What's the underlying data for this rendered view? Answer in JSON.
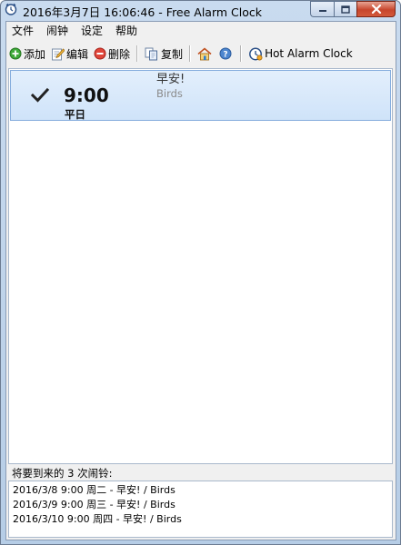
{
  "window": {
    "title": "2016年3月7日 16:06:46 - Free Alarm Clock"
  },
  "menu": {
    "items": [
      "文件",
      "闹钟",
      "设定",
      "帮助"
    ]
  },
  "toolbar": {
    "add_label": "添加",
    "edit_label": "编辑",
    "delete_label": "删除",
    "copy_label": "复制",
    "hot_label": "Hot Alarm Clock"
  },
  "alarms": [
    {
      "enabled": true,
      "time": "9:00",
      "days": "平日",
      "label": "早安!",
      "sound": "Birds"
    }
  ],
  "upcoming": {
    "title": "将要到来的 3 次闹铃:",
    "items": [
      "2016/3/8 9:00 周二 - 早安! / Birds",
      "2016/3/9 9:00 周三 - 早安! / Birds",
      "2016/3/10 9:00 周四 - 早安! / Birds"
    ]
  },
  "icons": {
    "app": "alarm-clock-icon",
    "add": "plus-circle-icon",
    "edit": "pencil-note-icon",
    "delete": "minus-circle-icon",
    "copy": "copy-pages-icon",
    "home": "home-icon",
    "help": "help-icon",
    "hot": "clock-icon",
    "check": "checkmark-icon"
  },
  "colors": {
    "selection_bg": "#d7e8fb",
    "selection_border": "#84acdd",
    "sound_text": "#8a8a8a"
  }
}
